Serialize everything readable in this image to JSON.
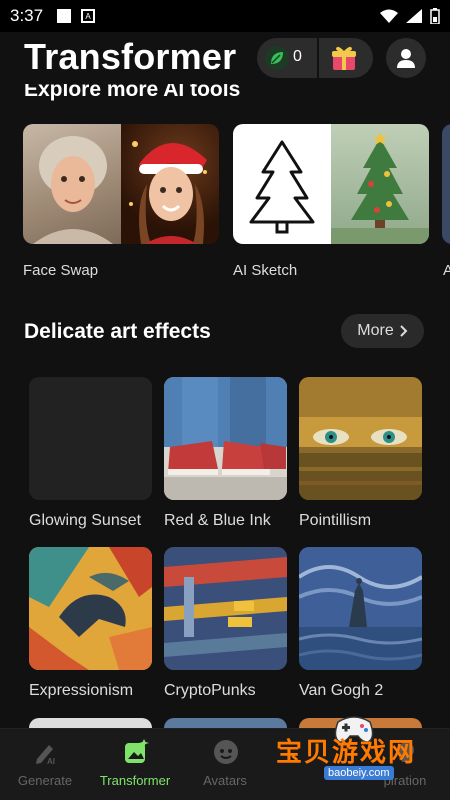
{
  "status_bar": {
    "time": "3:37"
  },
  "header": {
    "title": "Transformer",
    "coin_count": "0"
  },
  "explore": {
    "title": "Explore more AI tools",
    "tools": [
      {
        "label": "Face Swap"
      },
      {
        "label": "AI Sketch"
      },
      {
        "label": "A"
      }
    ]
  },
  "art_effects": {
    "title": "Delicate art effects",
    "more_label": "More",
    "items": [
      {
        "label": "Glowing Sunset"
      },
      {
        "label": "Red & Blue Ink"
      },
      {
        "label": "Pointillism"
      },
      {
        "label": "Expressionism"
      },
      {
        "label": "CryptoPunks"
      },
      {
        "label": "Van Gogh 2"
      }
    ]
  },
  "bottom_nav": {
    "items": [
      {
        "label": "Generate",
        "icon": "pen-ai-icon"
      },
      {
        "label": "Transformer",
        "icon": "image-sparkle-icon"
      },
      {
        "label": "Avatars",
        "icon": "face-icon"
      },
      {
        "label": "",
        "icon": "hidden-icon"
      },
      {
        "label": "piration",
        "icon": "bulb-icon"
      }
    ]
  },
  "watermark": {
    "text": "宝贝游戏网",
    "domain": "baobeiy.com"
  },
  "colors": {
    "accent": "#7fe36b",
    "background": "#111111",
    "card": "#2a2a2a"
  }
}
